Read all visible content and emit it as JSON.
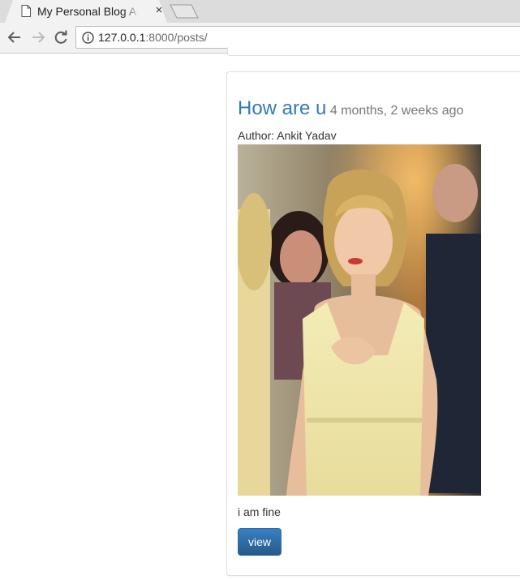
{
  "browser": {
    "tab_title": "My Personal Blog A",
    "tab_close": "×",
    "url_host": "127.0.0.1",
    "url_rest": ":8000/posts/"
  },
  "post": {
    "title": "How are u",
    "age": "4 months, 2 weeks ago",
    "author": "Author: Ankit Yadav",
    "body": "i am fine",
    "view_label": "view"
  }
}
